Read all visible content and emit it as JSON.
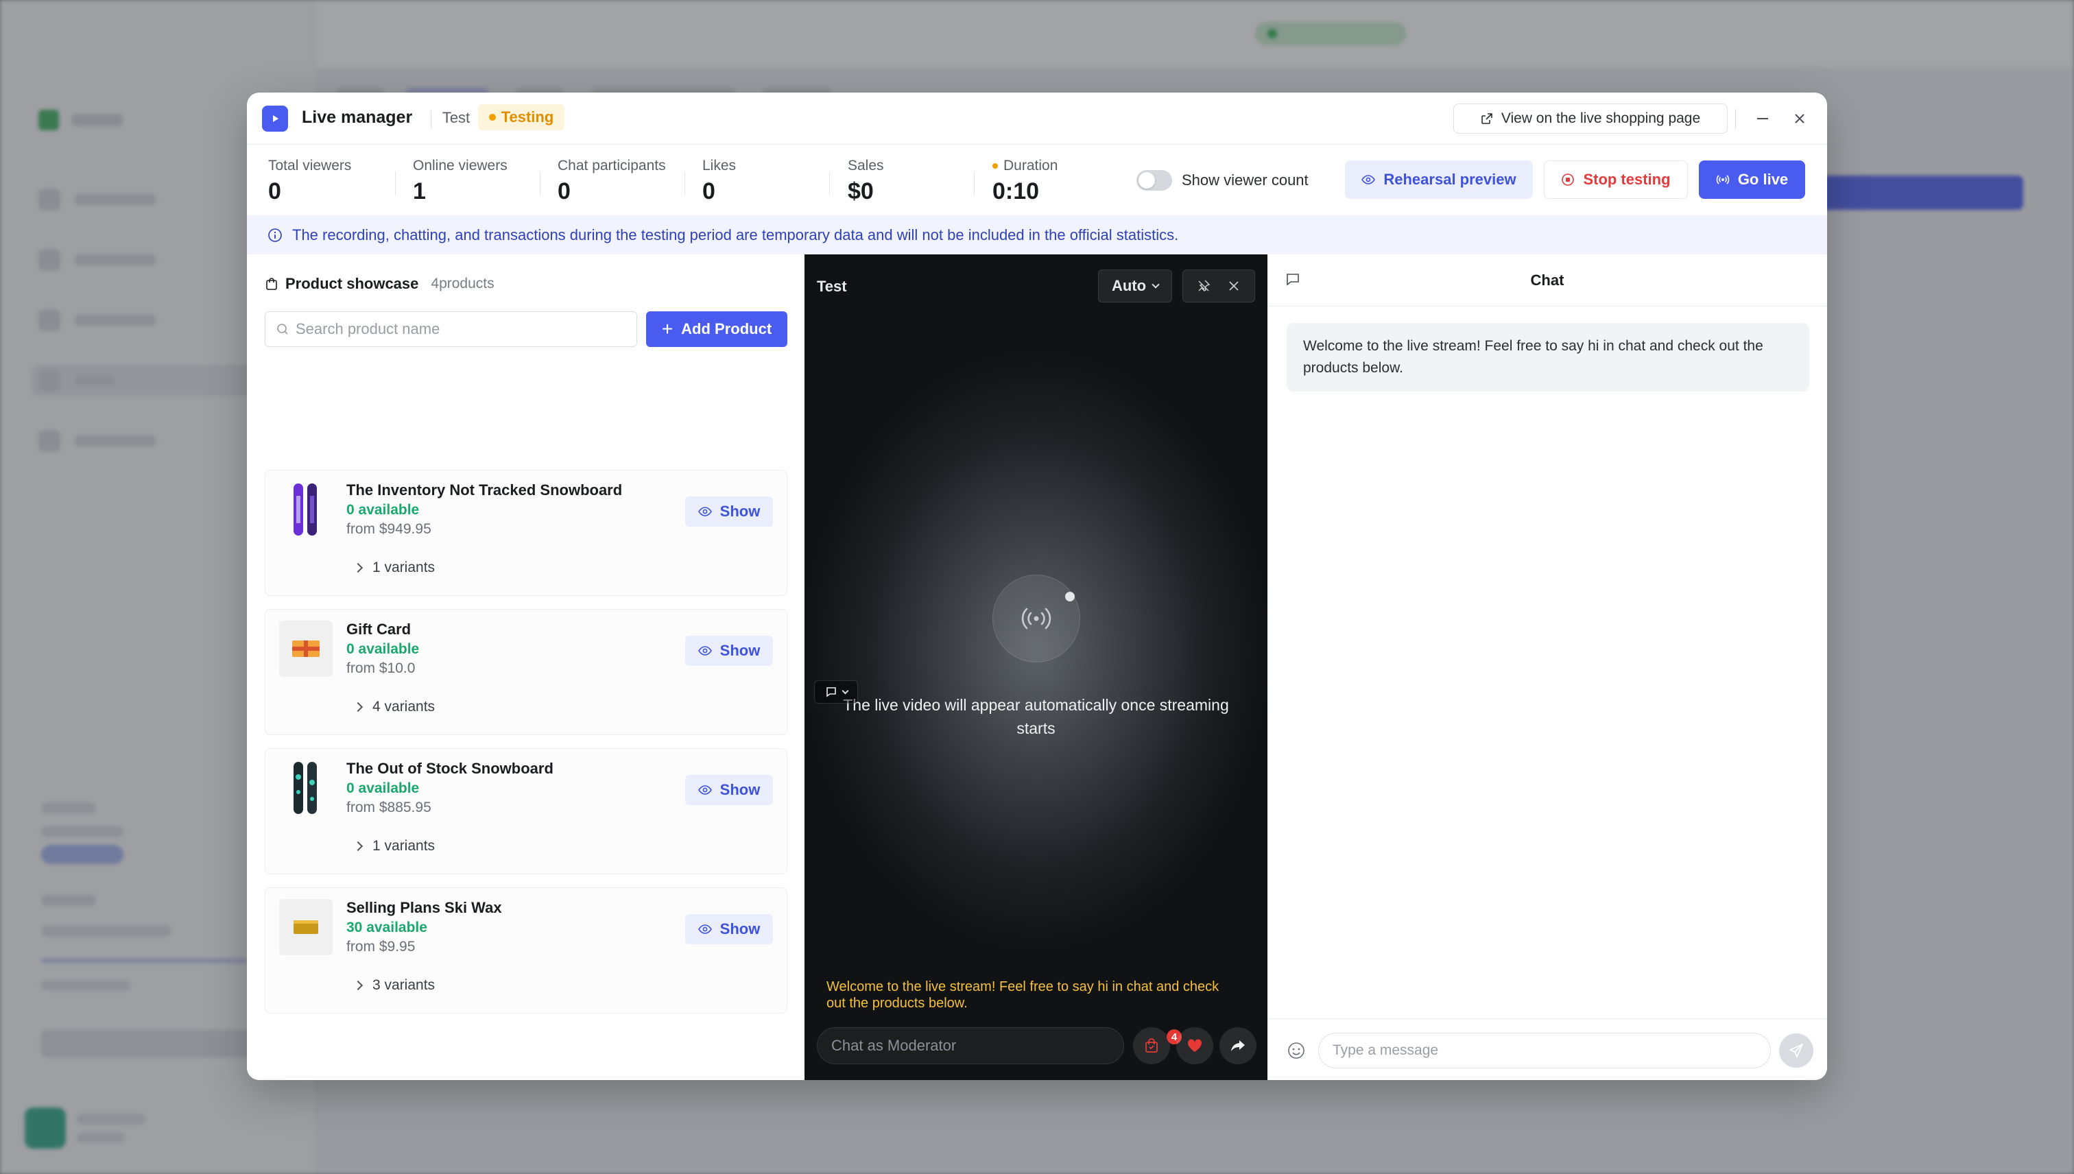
{
  "colors": {
    "accent": "#4a5cf0",
    "testing_badge": "#f0a100",
    "available_green": "#1aa86f",
    "stop_red": "#e23b3b",
    "chat_welcome_yellow": "#f4c13c"
  },
  "header": {
    "title": "Live manager",
    "stream_name": "Test",
    "status_badge": "Testing",
    "view_button": "View on the live shopping page",
    "icons": [
      "play-icon",
      "external-link-icon",
      "minimize-icon",
      "close-icon"
    ]
  },
  "stats": {
    "total_viewers": {
      "label": "Total viewers",
      "value": "0"
    },
    "online_viewers": {
      "label": "Online viewers",
      "value": "1"
    },
    "chat_participants": {
      "label": "Chat participants",
      "value": "0"
    },
    "likes": {
      "label": "Likes",
      "value": "0"
    },
    "sales": {
      "label": "Sales",
      "value": "$0"
    },
    "duration": {
      "label": "Duration",
      "value": "0:10"
    }
  },
  "controls": {
    "viewer_count_toggle": {
      "label": "Show viewer count",
      "on": false
    },
    "rehearsal_button": "Rehearsal preview",
    "stop_button": "Stop testing",
    "live_button": "Go live"
  },
  "banner": {
    "text": "The recording, chatting, and transactions during the testing period are temporary data and will not be included in the official statistics."
  },
  "products": {
    "title": "Product showcase",
    "count": "4products",
    "search_placeholder": "Search product name",
    "add_button": "Add Product",
    "show_label": "Show",
    "items": [
      {
        "name": "The Inventory Not Tracked Snowboard",
        "available": "0 available",
        "price": "from $949.95",
        "variants": "1 variants",
        "thumb": "snowboard-purple"
      },
      {
        "name": "Gift Card",
        "available": "0 available",
        "price": "from $10.0",
        "variants": "4 variants",
        "thumb": "gift-card"
      },
      {
        "name": "The Out of Stock Snowboard",
        "available": "0 available",
        "price": "from $885.95",
        "variants": "1 variants",
        "thumb": "snowboard-teal"
      },
      {
        "name": "Selling Plans Ski Wax",
        "available": "30 available",
        "price": "from $9.95",
        "variants": "3 variants",
        "thumb": "ski-wax"
      }
    ]
  },
  "video": {
    "label": "Test",
    "quality": "Auto",
    "placeholder": "The live video will appear automatically once streaming starts",
    "welcome": "Welcome to the live stream! Feel free to say hi in chat and check out the products below.",
    "chat_placeholder": "Chat as Moderator",
    "cart_count": "4"
  },
  "chat": {
    "title": "Chat",
    "welcome": "Welcome to the live stream! Feel free to say hi in chat and check out the products below.",
    "input_placeholder": "Type a message"
  }
}
